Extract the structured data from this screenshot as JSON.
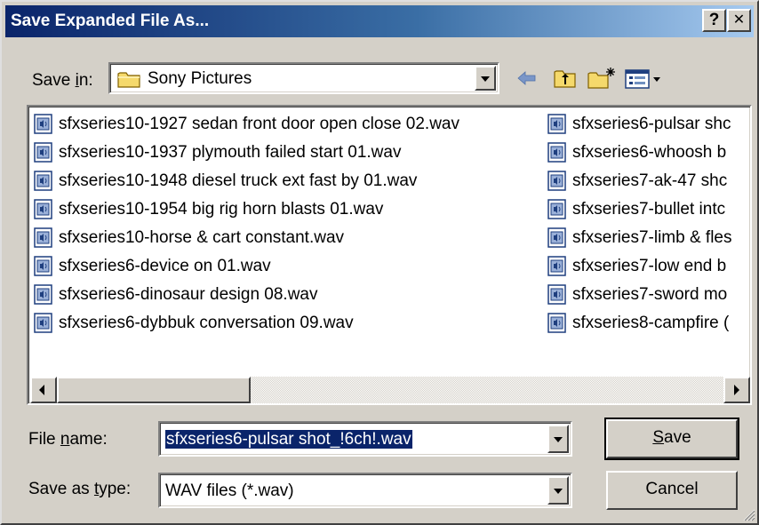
{
  "window": {
    "title": "Save Expanded File As...",
    "help_label": "?",
    "close_label": "✕"
  },
  "save_in": {
    "label_pre": "Save ",
    "label_accel": "i",
    "label_post": "n:",
    "value": "Sony Pictures",
    "icon": "folder-icon"
  },
  "toolbar": {
    "icons": [
      "back-arrow-icon",
      "up-one-level-icon",
      "new-folder-icon",
      "view-menu-icon"
    ]
  },
  "files": {
    "column1": [
      "sfxseries10-1927 sedan front door open close 02.wav",
      "sfxseries10-1937 plymouth failed start 01.wav",
      "sfxseries10-1948 diesel truck ext fast by 01.wav",
      "sfxseries10-1954 big rig horn blasts 01.wav",
      "sfxseries10-horse & cart constant.wav",
      "sfxseries6-device on 01.wav",
      "sfxseries6-dinosaur design 08.wav",
      "sfxseries6-dybbuk conversation 09.wav"
    ],
    "column2": [
      "sfxseries6-pulsar shc",
      "sfxseries6-whoosh b",
      "sfxseries7-ak-47 shc",
      "sfxseries7-bullet intc",
      "sfxseries7-limb & fles",
      "sfxseries7-low end b",
      "sfxseries7-sword mo",
      "sfxseries8-campfire ("
    ],
    "icon": "wav-file-icon"
  },
  "file_name": {
    "label_pre": "File ",
    "label_accel": "n",
    "label_post": "ame:",
    "value": "sfxseries6-pulsar shot_!6ch!.wav"
  },
  "save_type": {
    "label_pre": "Save as ",
    "label_accel": "t",
    "label_post": "ype:",
    "value": "WAV files (*.wav)"
  },
  "buttons": {
    "save_accel": "S",
    "save_rest": "ave",
    "cancel": "Cancel"
  },
  "colors": {
    "title_start": "#0a246a",
    "title_end": "#a6caf0",
    "face": "#d4d0c8",
    "selection": "#0a246a",
    "folder": "#f5d96b"
  }
}
